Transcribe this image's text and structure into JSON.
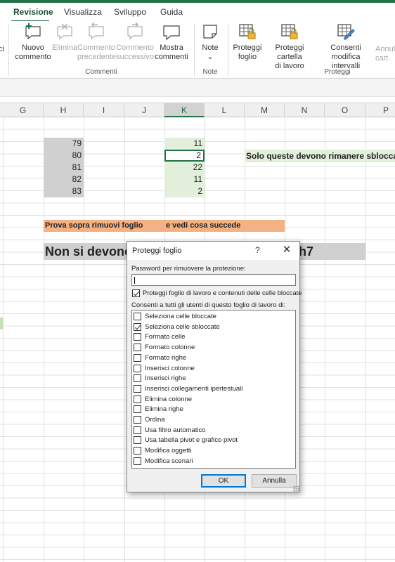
{
  "ribbon_tabs": [
    {
      "label": "Revisione",
      "active": true
    },
    {
      "label": "Visualizza"
    },
    {
      "label": "Sviluppo"
    },
    {
      "label": "Guida"
    }
  ],
  "ribbon": {
    "edge_partial": "ci",
    "comments": {
      "group_label": "Commenti",
      "new_comment": [
        "Nuovo",
        "commento"
      ],
      "delete": "Elimina",
      "previous": [
        "Commento",
        "precedente"
      ],
      "next": [
        "Commento",
        "successivo"
      ],
      "show": [
        "Mostra",
        "commenti"
      ]
    },
    "notes": {
      "group_label": "Note",
      "notes": "Note",
      "chevron": "⌄"
    },
    "protect": {
      "group_label": "Proteggi",
      "sheet": [
        "Proteggi",
        "foglio"
      ],
      "workbook": [
        "Proteggi cartella",
        "di lavoro"
      ],
      "ranges": [
        "Consenti",
        "modifica intervalli"
      ],
      "unshare_partial": [
        "Annul",
        "cart"
      ]
    }
  },
  "columns": [
    "G",
    "H",
    "I",
    "J",
    "K",
    "L",
    "M",
    "N",
    "O",
    "P"
  ],
  "cells": {
    "H": [
      "79",
      "80",
      "81",
      "82",
      "83"
    ],
    "K": [
      "11",
      "2",
      "22",
      "11",
      "2"
    ]
  },
  "note_unlocked": "Solo queste devono rimanere sbloccate",
  "orange_row": {
    "a": "Prova  sopra rimuovi foglio",
    "b": "e vedi cosa succede"
  },
  "gray_row": {
    "left": "Non  si devono v",
    "right": "h7"
  },
  "dialog": {
    "title": "Proteggi foglio",
    "help": "?",
    "close": "✕",
    "password_label": "Password per rimuovere la protezione:",
    "password_value": "",
    "protect_label": "Proteggi foglio di lavoro e contenuti delle celle bloccate",
    "protect_checked": true,
    "allow_label": "Consenti a tutti gli utenti di questo foglio di lavoro di:",
    "options": [
      {
        "label": "Seleziona celle bloccate",
        "checked": false
      },
      {
        "label": "Seleziona celle sbloccate",
        "checked": true
      },
      {
        "label": "Formato celle",
        "checked": false
      },
      {
        "label": "Formato colonne",
        "checked": false
      },
      {
        "label": "Formato righe",
        "checked": false
      },
      {
        "label": "Inserisci colonne",
        "checked": false
      },
      {
        "label": "Inserisci righe",
        "checked": false
      },
      {
        "label": "Inserisci collegamenti ipertestuali",
        "checked": false
      },
      {
        "label": "Elimina colonne",
        "checked": false
      },
      {
        "label": "Elimina righe",
        "checked": false
      },
      {
        "label": "Ordina",
        "checked": false
      },
      {
        "label": "Usa filtro automatico",
        "checked": false
      },
      {
        "label": "Usa tabella pivot e grafico pivot",
        "checked": false
      },
      {
        "label": "Modifica oggetti",
        "checked": false
      },
      {
        "label": "Modifica scenari",
        "checked": false
      }
    ],
    "ok": "OK",
    "cancel": "Annulla"
  },
  "colors": {
    "accent": "#217346",
    "locked_fill": "#d0d0d0",
    "unlocked_fill": "#e2efda",
    "orange_fill": "#f4b183",
    "focus": "#0078d7"
  }
}
